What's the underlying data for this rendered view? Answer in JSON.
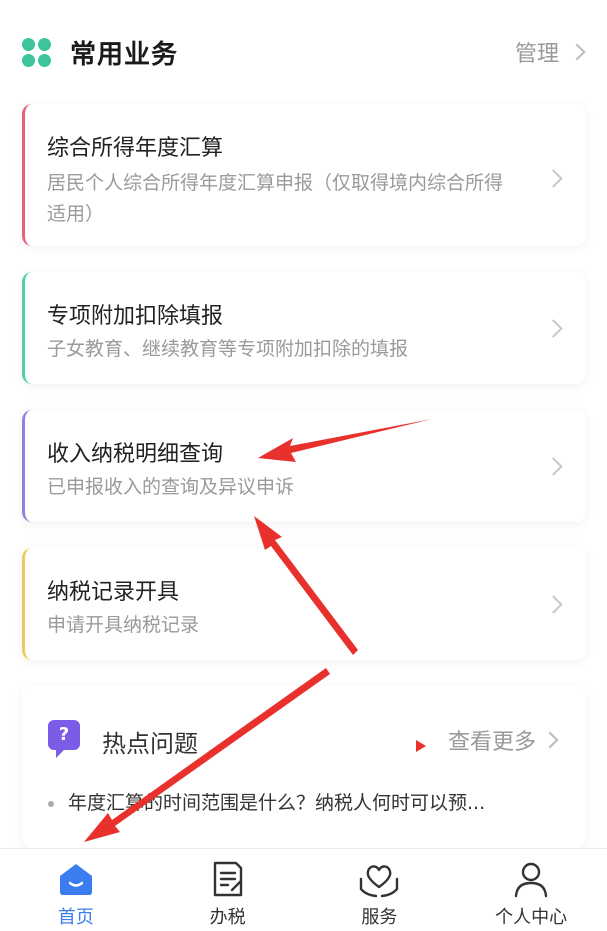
{
  "header": {
    "title": "常用业务",
    "manage_label": "管理"
  },
  "cards": [
    {
      "title": "综合所得年度汇算",
      "desc": "居民个人综合所得年度汇算申报（仅取得境内综合所得适用）",
      "accent": "#e5607a"
    },
    {
      "title": "专项附加扣除填报",
      "desc": "子女教育、继续教育等专项附加扣除的填报",
      "accent": "#55cf9c"
    },
    {
      "title": "收入纳税明细查询",
      "desc": "已申报收入的查询及异议申诉",
      "accent": "#8b84e0"
    },
    {
      "title": "纳税记录开具",
      "desc": "申请开具纳税记录",
      "accent": "#f2c95c"
    }
  ],
  "hot": {
    "icon": "question-icon",
    "icon_glyph": "?",
    "title": "热点问题",
    "more_label": "查看更多",
    "items": [
      "年度汇算的时间范围是什么？纳税人何时可以预..."
    ]
  },
  "tabbar": {
    "items": [
      {
        "label": "首页",
        "icon": "home-icon",
        "active": true
      },
      {
        "label": "办税",
        "icon": "document-icon",
        "active": false
      },
      {
        "label": "服务",
        "icon": "heart-hands-icon",
        "active": false
      },
      {
        "label": "个人中心",
        "icon": "user-icon",
        "active": false
      }
    ]
  },
  "colors": {
    "accent": "#3b7cf0",
    "annotation": "#e8302c",
    "brand_green": "#3cc59a"
  }
}
